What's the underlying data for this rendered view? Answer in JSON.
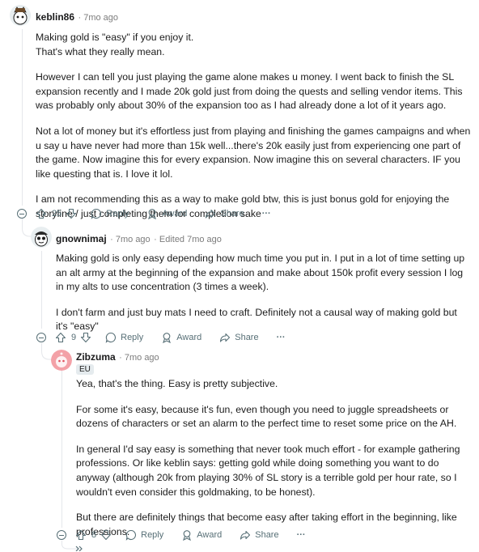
{
  "comments": [
    {
      "author": "keblin86",
      "time": "7mo ago",
      "paragraphs": [
        "Making gold is \"easy\" if you enjoy it.\nThat's what they really mean.",
        "However I can tell you just playing the game alone makes u money. I went back to finish the SL expansion recently and I made 20k gold just from doing the quests and selling vendor items. This was probably only about 30% of the expansion too as I had already done a lot of it years ago.",
        "Not a lot of money but it's effortless just from playing and finishing the games campaigns and when u say u have never had more than 15k well...there's 20k easily just from experiencing one part of the game. Now imagine this for every expansion. Now imagine this on several characters. IF you like questing that is. I love it lol.",
        "I am not recommending this as a way to make gold btw, this is just bonus gold for enjoying the storyline / just completing them for completion sake"
      ],
      "votes": "25",
      "reply_label": "Reply",
      "award_label": "Award",
      "share_label": "Share",
      "more_label": "···"
    },
    {
      "author": "gnownimaj",
      "time": "7mo ago",
      "edited": "Edited 7mo ago",
      "paragraphs": [
        "Making gold is only easy depending how much time you put in. I put in a lot of time setting up an alt army at the beginning of the expansion and make about 150k profit every session I log in my alts to use concentration (3 times a week).",
        "I don't farm and just buy mats I need to craft. Definitely not a causal way of making gold but it's \"easy\""
      ],
      "votes": "9",
      "reply_label": "Reply",
      "award_label": "Award",
      "share_label": "Share",
      "more_label": "···"
    },
    {
      "author": "Zibzuma",
      "time": "7mo ago",
      "flair": "EU",
      "paragraphs": [
        "Yea, that's the thing. Easy is pretty subjective.",
        "For some it's easy, because it's fun, even though you need to juggle spreadsheets or dozens of characters or set an alarm to the perfect time to reset some price on the AH.",
        "In general I'd say easy is something that never took much effort - for example gathering professions. Or like keblin says: getting gold while doing something you want to do anyway (although 20k from playing 30% of SL story is a terrible gold per hour rate, so I wouldn't even consider this goldmaking, to be honest).",
        "But there are definitely things that become easy after taking effort in the beginning, like professions."
      ],
      "votes": "8",
      "reply_label": "Reply",
      "award_label": "Award",
      "share_label": "Share",
      "more_label": "···"
    }
  ],
  "colors": {
    "meta_text": "#7c7c7c",
    "action_text": "#576f76",
    "thread_line": "#e5e7eb",
    "flair_bg": "#e5ebee",
    "zibzuma_avatar": "#f3a1a7"
  },
  "icons": [
    "upvote-icon",
    "downvote-icon",
    "comment-bubble-icon",
    "award-icon",
    "share-icon",
    "more-icon",
    "collapse-icon"
  ]
}
